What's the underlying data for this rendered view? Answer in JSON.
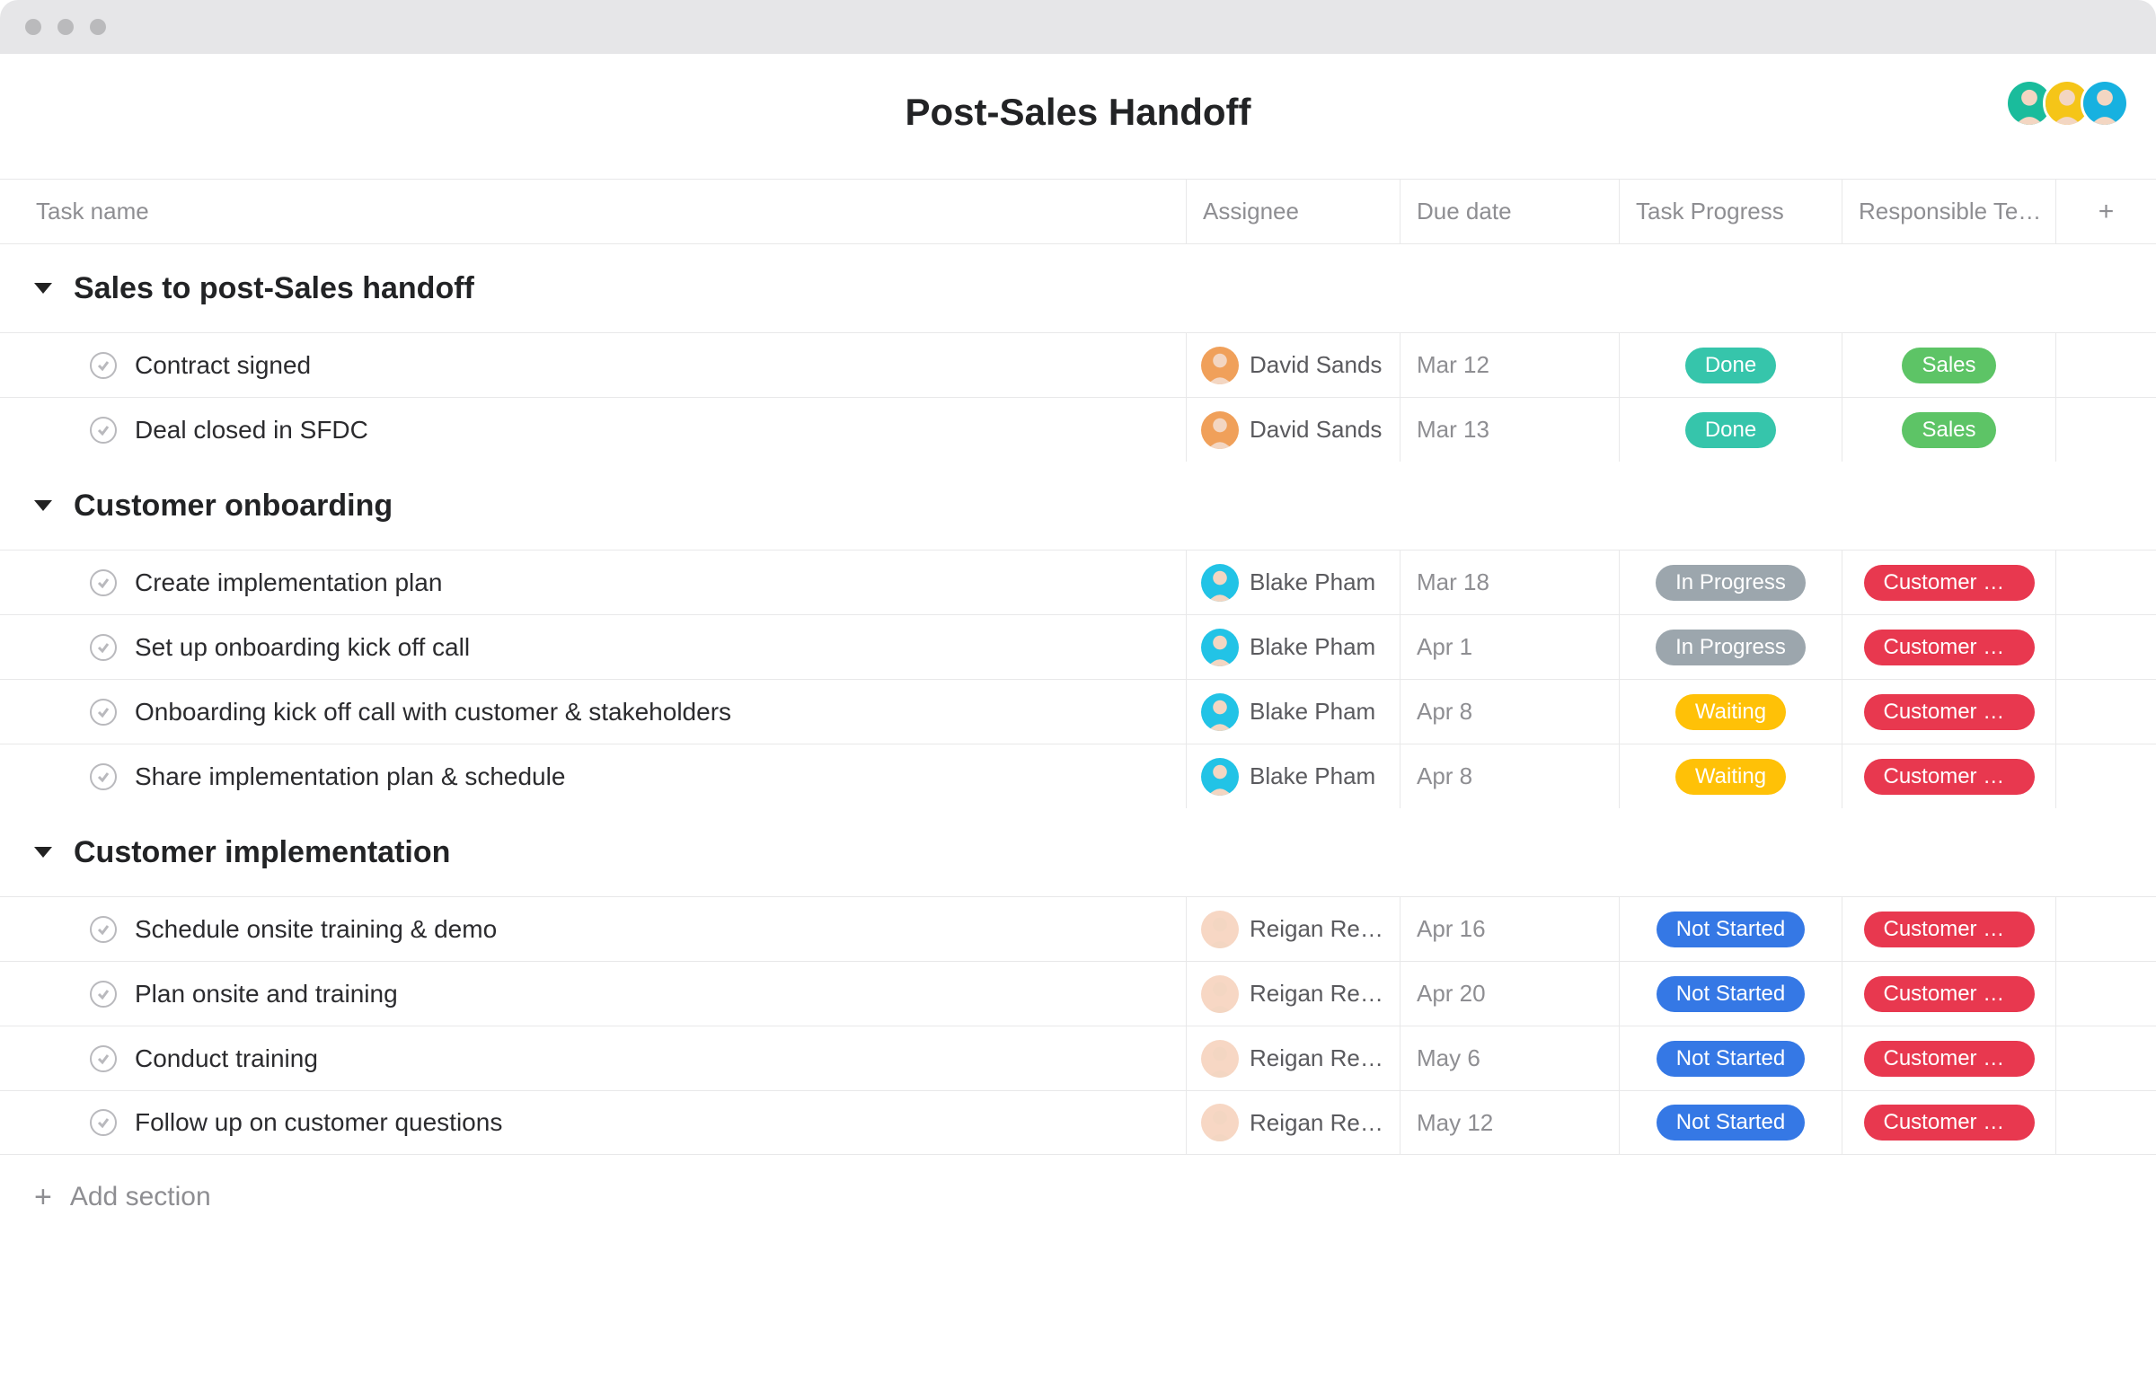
{
  "page": {
    "title": "Post-Sales Handoff",
    "add_section_label": "Add section"
  },
  "columns": {
    "task": "Task name",
    "assignee": "Assignee",
    "due": "Due date",
    "progress": "Task Progress",
    "team": "Responsible Te…"
  },
  "palette": {
    "done": "#36c5ab",
    "in_progress": "#9ca6ad",
    "waiting": "#ffc107",
    "not_started": "#3578e5",
    "sales": "#5dc466",
    "customer_success": "#e8384f"
  },
  "header_avatars": [
    {
      "bg": "#1abc9c"
    },
    {
      "bg": "#f5c518"
    },
    {
      "bg": "#17b1e0"
    }
  ],
  "assignees": {
    "david": {
      "name": "David Sands",
      "bg": "#f0a05a"
    },
    "blake": {
      "name": "Blake Pham",
      "bg": "#22c3e6"
    },
    "reigan": {
      "name": "Reigan Rea…",
      "bg": "#f7d7c4"
    }
  },
  "sections": [
    {
      "title": "Sales to post-Sales handoff",
      "tasks": [
        {
          "name": "Contract signed",
          "assignee": "david",
          "due": "Mar 12",
          "progress": {
            "label": "Done",
            "color": "done"
          },
          "team": {
            "label": "Sales",
            "color": "sales"
          }
        },
        {
          "name": "Deal closed in SFDC",
          "assignee": "david",
          "due": "Mar 13",
          "progress": {
            "label": "Done",
            "color": "done"
          },
          "team": {
            "label": "Sales",
            "color": "sales"
          }
        }
      ]
    },
    {
      "title": "Customer onboarding",
      "tasks": [
        {
          "name": "Create implementation plan",
          "assignee": "blake",
          "due": "Mar 18",
          "progress": {
            "label": "In Progress",
            "color": "in_progress"
          },
          "team": {
            "label": "Customer Suc…",
            "color": "customer_success"
          }
        },
        {
          "name": "Set up onboarding kick off call",
          "assignee": "blake",
          "due": "Apr 1",
          "progress": {
            "label": "In Progress",
            "color": "in_progress"
          },
          "team": {
            "label": "Customer Suc…",
            "color": "customer_success"
          }
        },
        {
          "name": "Onboarding kick off call with customer & stakeholders",
          "assignee": "blake",
          "due": "Apr 8",
          "progress": {
            "label": "Waiting",
            "color": "waiting"
          },
          "team": {
            "label": "Customer Suc…",
            "color": "customer_success"
          }
        },
        {
          "name": "Share implementation plan & schedule",
          "assignee": "blake",
          "due": "Apr 8",
          "progress": {
            "label": "Waiting",
            "color": "waiting"
          },
          "team": {
            "label": "Customer Suc…",
            "color": "customer_success"
          }
        }
      ]
    },
    {
      "title": "Customer implementation",
      "tasks": [
        {
          "name": "Schedule onsite training & demo",
          "assignee": "reigan",
          "due": "Apr 16",
          "progress": {
            "label": "Not Started",
            "color": "not_started"
          },
          "team": {
            "label": "Customer Suc…",
            "color": "customer_success"
          }
        },
        {
          "name": "Plan onsite and training",
          "assignee": "reigan",
          "due": "Apr 20",
          "progress": {
            "label": "Not Started",
            "color": "not_started"
          },
          "team": {
            "label": "Customer Suc…",
            "color": "customer_success"
          }
        },
        {
          "name": "Conduct training",
          "assignee": "reigan",
          "due": "May 6",
          "progress": {
            "label": "Not Started",
            "color": "not_started"
          },
          "team": {
            "label": "Customer Suc…",
            "color": "customer_success"
          }
        },
        {
          "name": "Follow up on customer questions",
          "assignee": "reigan",
          "due": "May 12",
          "progress": {
            "label": "Not Started",
            "color": "not_started"
          },
          "team": {
            "label": "Customer Suc…",
            "color": "customer_success"
          }
        }
      ]
    }
  ]
}
